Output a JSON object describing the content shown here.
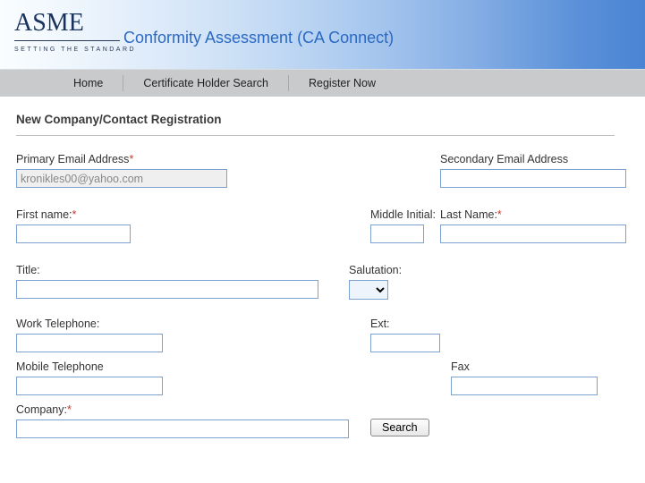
{
  "header": {
    "logo_word": "ASME",
    "logo_tag": "SETTING THE STANDARD",
    "app_title": "Conformity Assessment (CA Connect)"
  },
  "nav": {
    "items": [
      "Home",
      "Certificate Holder Search",
      "Register Now"
    ]
  },
  "form": {
    "title": "New Company/Contact Registration",
    "primary_email_label": "Primary Email Address",
    "primary_email_value": "kronikles00@yahoo.com",
    "secondary_email_label": "Secondary Email Address",
    "secondary_email_value": "",
    "first_name_label": "First name:",
    "first_name_value": "",
    "middle_initial_label": "Middle Initial:",
    "middle_initial_value": "",
    "last_name_label": "Last Name:",
    "last_name_value": "",
    "title_label": "Title:",
    "title_value": "",
    "salutation_label": "Salutation:",
    "work_tel_label": "Work Telephone:",
    "work_tel_value": "",
    "ext_label": "Ext:",
    "ext_value": "",
    "mobile_tel_label": "Mobile Telephone",
    "mobile_tel_value": "",
    "fax_label": "Fax",
    "fax_value": "",
    "company_label": "Company:",
    "company_value": "",
    "search_button": "Search"
  }
}
